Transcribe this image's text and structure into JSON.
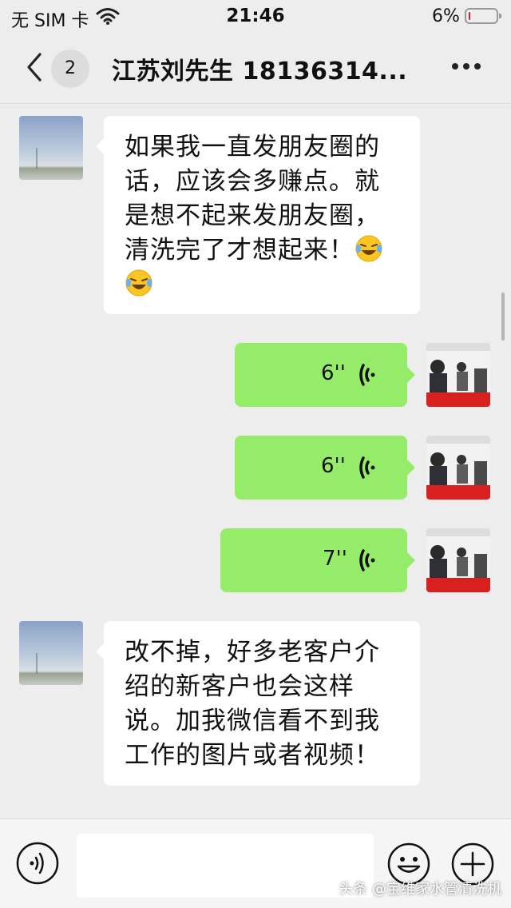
{
  "status_bar": {
    "carrier": "无 SIM 卡",
    "time": "21:46",
    "battery_percent": "6%",
    "battery_level": 0.06,
    "battery_color": "#e02020"
  },
  "nav": {
    "back_icon": "chevron-left-icon",
    "unread_count": "2",
    "title": "江苏刘先生 18136314...",
    "more_icon": "ellipsis-icon"
  },
  "messages": [
    {
      "direction": "incoming",
      "type": "text",
      "text_lines": [
        "如果我一直发朋友圈的",
        "话，应该会多赚点。就",
        "是想不起来发朋友圈，",
        "清洗完了才想起来！"
      ],
      "emojis": [
        "laugh-cry-emoji",
        "laugh-cry-emoji"
      ]
    },
    {
      "direction": "outgoing",
      "type": "voice",
      "duration": "6''"
    },
    {
      "direction": "outgoing",
      "type": "voice",
      "duration": "6''"
    },
    {
      "direction": "outgoing",
      "type": "voice",
      "duration": "7''"
    },
    {
      "direction": "incoming",
      "type": "text",
      "text_lines": [
        "改不掉，好多老客户介",
        "绍的新客户也会这样",
        "说。加我微信看不到我",
        "工作的图片或者视频！"
      ]
    }
  ],
  "input_bar": {
    "voice_icon": "voice-mode-icon",
    "emoji_icon": "emoji-icon",
    "plus_icon": "plus-icon",
    "placeholder": ""
  },
  "watermark": "头条 @宝维家水管清洗机",
  "colors": {
    "background": "#ededed",
    "outgoing_bubble": "#95ec69",
    "incoming_bubble": "#ffffff"
  }
}
